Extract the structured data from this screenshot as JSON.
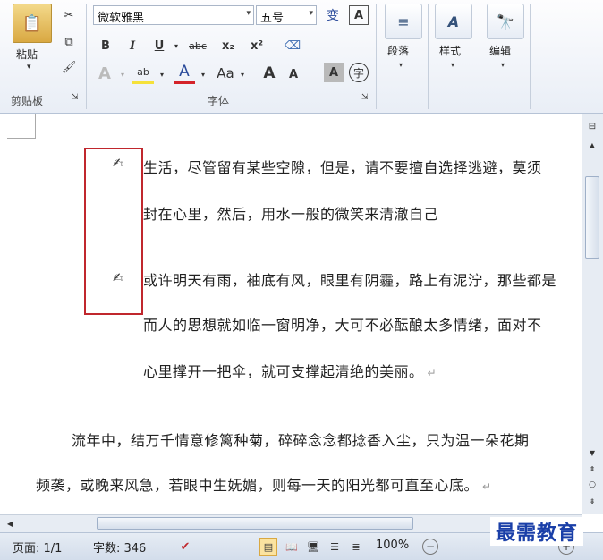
{
  "ribbon": {
    "clipboard": {
      "paste_label": "粘贴",
      "group_label": "剪贴板"
    },
    "font": {
      "font_name": "微软雅黑",
      "font_size": "五号",
      "bold": "B",
      "italic": "I",
      "underline": "U",
      "strike": "abc",
      "subscript": "x₂",
      "superscript": "x²",
      "font_color_letter": "A",
      "case_label": "Aa",
      "grow": "A",
      "shrink": "A",
      "char_border": "A",
      "enclose": "字",
      "phonetic": "变",
      "group_label": "字体"
    },
    "paragraph_label": "段落",
    "styles_label": "样式",
    "editing_label": "编辑"
  },
  "document": {
    "lines": [
      "生活，尽管留有某些空隙，但是，请不要擅自选择逃避，莫须",
      "封在心里，然后，用水一般的微笑来清澈自己",
      "或许明天有雨，袖底有风，眼里有阴霾，路上有泥泞，那些都是",
      "而人的思想就如临一窗明净，大可不必酝酿太多情绪，面对不",
      "心里撑开一把伞，就可支撑起清绝的美丽。",
      "流年中，结万千情意修篱种菊，碎碎念念都捻香入尘，只为温一朵花期",
      "频袭，或晚来风急，若眼中生妩媚，则每一天的阳光都可直至心底。"
    ],
    "bullet_symbol": "✍",
    "para_mark": "↵"
  },
  "status": {
    "page": "页面: 1/1",
    "words": "字数: 346",
    "zoom": "100%"
  },
  "watermark": "最需教育",
  "colors": {
    "highlight": "#f5e13a",
    "font_red": "#d4232a",
    "annotation_red": "#c0272d",
    "watermark_blue": "#1a3fa8"
  }
}
